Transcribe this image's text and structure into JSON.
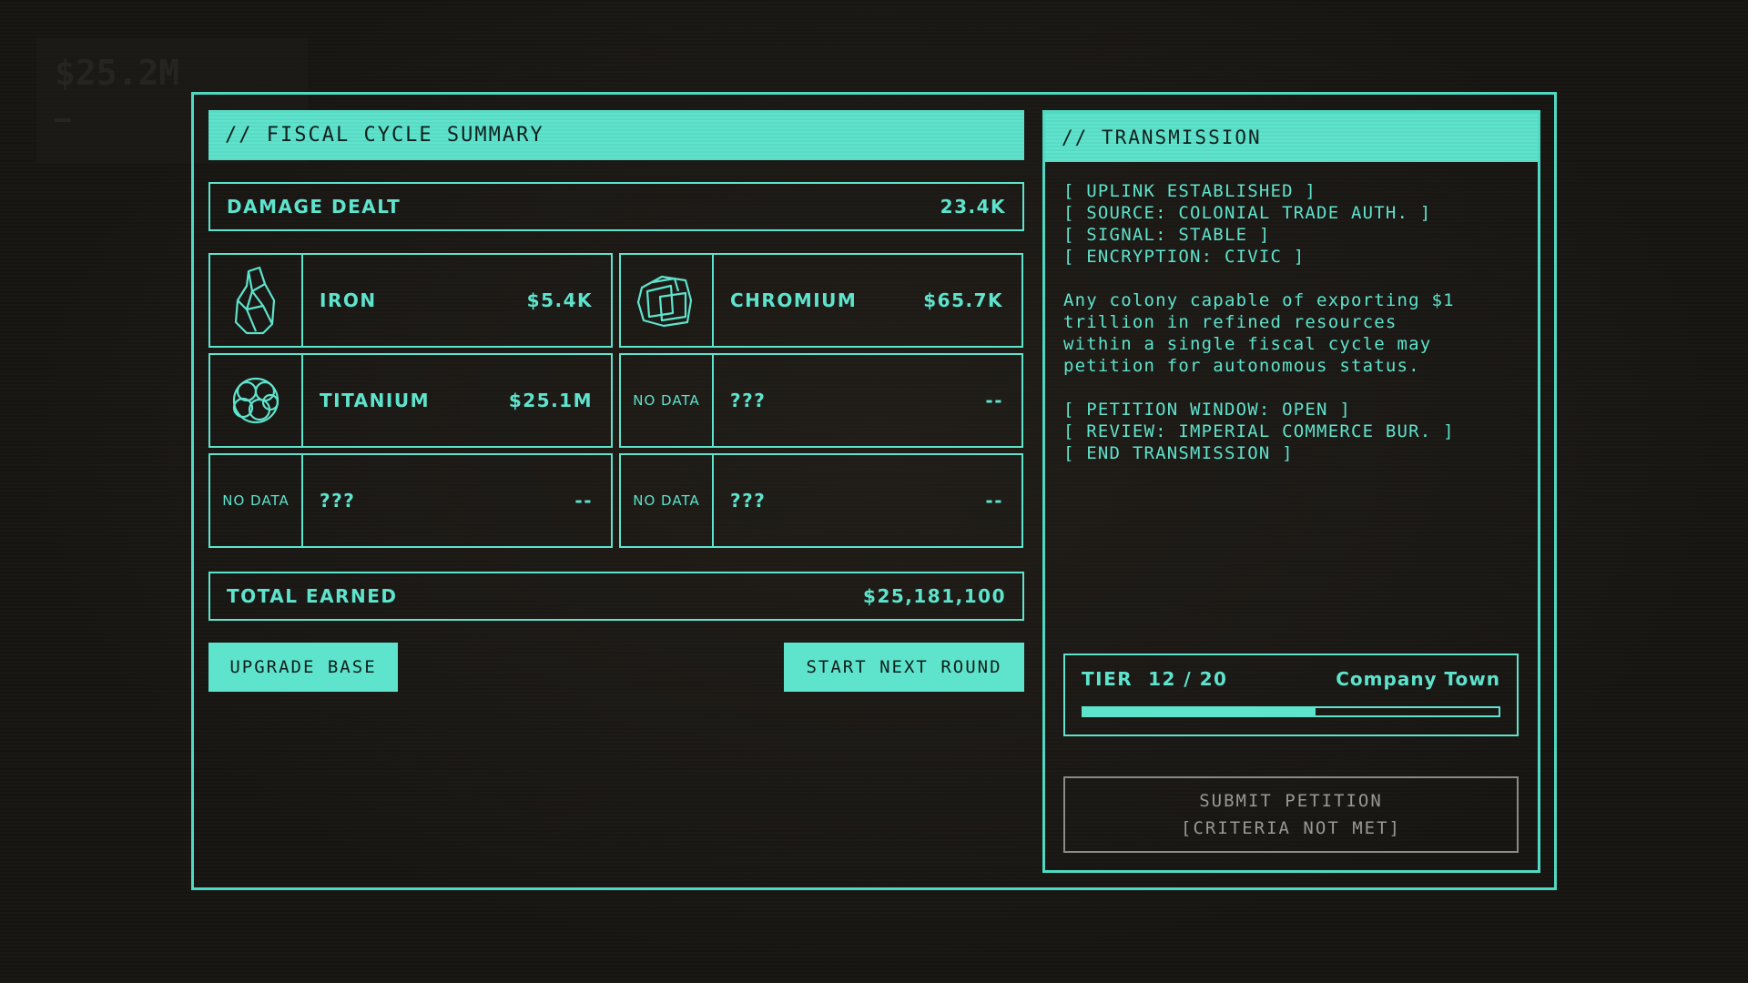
{
  "ghost_hud": {
    "money": "$25.2M"
  },
  "summary": {
    "title": "// FISCAL CYCLE SUMMARY",
    "damage": {
      "label": "DAMAGE DEALT",
      "value": "23.4K"
    },
    "resources": [
      {
        "icon": "iron-ore-icon",
        "icon_text": "",
        "name": "IRON",
        "value": "$5.4K"
      },
      {
        "icon": "chromium-ore-icon",
        "icon_text": "",
        "name": "CHROMIUM",
        "value": "$65.7K"
      },
      {
        "icon": "titanium-ore-icon",
        "icon_text": "",
        "name": "TITANIUM",
        "value": "$25.1M"
      },
      {
        "icon": "",
        "icon_text": "NO DATA",
        "name": "???",
        "value": "--"
      },
      {
        "icon": "",
        "icon_text": "NO DATA",
        "name": "???",
        "value": "--"
      },
      {
        "icon": "",
        "icon_text": "NO DATA",
        "name": "???",
        "value": "--"
      }
    ],
    "total": {
      "label": "TOTAL EARNED",
      "value": "$25,181,100"
    },
    "upgrade_label": "UPGRADE BASE",
    "next_round_label": "START NEXT ROUND"
  },
  "transmission": {
    "title": "// TRANSMISSION",
    "header_lines": [
      "[ UPLINK ESTABLISHED ]",
      "[ SOURCE: COLONIAL TRADE AUTH. ]",
      "[ SIGNAL: STABLE ]",
      "[ ENCRYPTION: CIVIC ]"
    ],
    "message_lines": [
      "Any colony capable of exporting $1",
      "trillion in refined resources",
      "within a single fiscal cycle may",
      "petition for autonomous status."
    ],
    "footer_lines": [
      "[ PETITION WINDOW: OPEN ]",
      "[ REVIEW: IMPERIAL COMMERCE BUR. ]",
      "[ END TRANSMISSION ]"
    ]
  },
  "tier": {
    "label": "TIER  12 / 20",
    "current": 12,
    "max": 20,
    "name": "Company Town",
    "progress": 0.56
  },
  "submit": {
    "line1": "SUBMIT PETITION",
    "line2": "[CRITERIA NOT MET]"
  },
  "colors": {
    "accent": "#5ee3cc",
    "background": "#171512",
    "disabled": "#9a9892"
  }
}
